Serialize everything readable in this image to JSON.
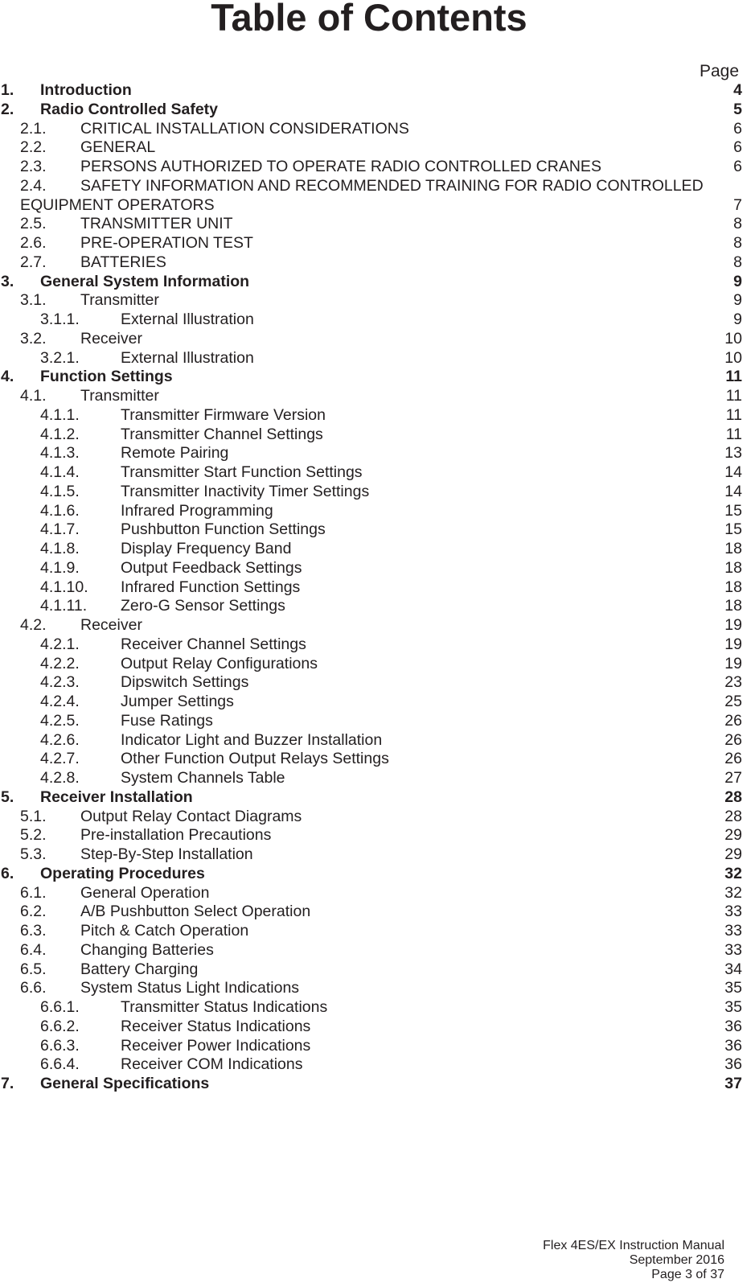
{
  "title": "Table of Contents",
  "page_column_header": "Page",
  "entries": [
    {
      "level": 1,
      "num": "1.",
      "text": "Introduction",
      "page": "4"
    },
    {
      "level": 1,
      "num": "2.",
      "text": "Radio Controlled Safety",
      "page": "5"
    },
    {
      "level": 2,
      "num": "2.1.",
      "text": "CRITICAL INSTALLATION CONSIDERATIONS",
      "page": "6"
    },
    {
      "level": 2,
      "num": "2.2.",
      "text": "GENERAL",
      "page": "6"
    },
    {
      "level": 2,
      "num": "2.3.",
      "text": "PERSONS AUTHORIZED TO OPERATE RADIO CONTROLLED CRANES",
      "page": "6"
    },
    {
      "level": 2,
      "num": "2.4.",
      "text": "SAFETY INFORMATION AND RECOMMENDED TRAINING FOR RADIO CONTROLLED",
      "text_cont": "EQUIPMENT OPERATORS",
      "page": "7"
    },
    {
      "level": 2,
      "num": "2.5.",
      "text": "TRANSMITTER UNIT",
      "page": "8"
    },
    {
      "level": 2,
      "num": "2.6.",
      "text": "PRE-OPERATION TEST",
      "page": "8"
    },
    {
      "level": 2,
      "num": "2.7.",
      "text": "BATTERIES",
      "page": "8"
    },
    {
      "level": 1,
      "num": "3.",
      "text": "General System Information",
      "page": "9"
    },
    {
      "level": 2,
      "num": "3.1.",
      "text": "Transmitter",
      "page": "9"
    },
    {
      "level": 3,
      "num": "3.1.1.",
      "text": "External Illustration",
      "page": "9"
    },
    {
      "level": 2,
      "num": "3.2.",
      "text": "Receiver",
      "page": "10"
    },
    {
      "level": 3,
      "num": "3.2.1.",
      "text": "External Illustration",
      "page": "10"
    },
    {
      "level": 1,
      "num": "4.",
      "text": "Function Settings",
      "page": "11"
    },
    {
      "level": 2,
      "num": "4.1.",
      "text": "Transmitter",
      "page": "11"
    },
    {
      "level": 3,
      "num": "4.1.1.",
      "text": "Transmitter Firmware Version",
      "page": "11"
    },
    {
      "level": 3,
      "num": "4.1.2.",
      "text": "Transmitter Channel Settings",
      "page": "11"
    },
    {
      "level": 3,
      "num": "4.1.3.",
      "text": "Remote Pairing",
      "page": "13"
    },
    {
      "level": 3,
      "num": "4.1.4.",
      "text": "Transmitter Start Function Settings",
      "page": "14"
    },
    {
      "level": 3,
      "num": "4.1.5.",
      "text": "Transmitter Inactivity Timer Settings",
      "page": "14"
    },
    {
      "level": 3,
      "num": "4.1.6.",
      "text": "Infrared Programming",
      "page": "15"
    },
    {
      "level": 3,
      "num": "4.1.7.",
      "text": "Pushbutton Function Settings",
      "page": "15"
    },
    {
      "level": 3,
      "num": "4.1.8.",
      "text": "Display Frequency Band",
      "page": "18"
    },
    {
      "level": 3,
      "num": "4.1.9.",
      "text": "Output Feedback Settings",
      "page": "18"
    },
    {
      "level": 3,
      "num": "4.1.10.",
      "text": "Infrared Function Settings",
      "page": "18"
    },
    {
      "level": 3,
      "num": "4.1.11.",
      "text": "Zero-G Sensor Settings",
      "page": "18"
    },
    {
      "level": 2,
      "num": "4.2.",
      "text": "Receiver",
      "page": "19"
    },
    {
      "level": 3,
      "num": "4.2.1.",
      "text": "Receiver Channel Settings",
      "page": "19"
    },
    {
      "level": 3,
      "num": "4.2.2.",
      "text": "Output Relay Configurations",
      "page": "19"
    },
    {
      "level": 3,
      "num": "4.2.3.",
      "text": "Dipswitch Settings",
      "page": "23"
    },
    {
      "level": 3,
      "num": "4.2.4.",
      "text": "Jumper Settings",
      "page": "25"
    },
    {
      "level": 3,
      "num": "4.2.5.",
      "text": "Fuse Ratings",
      "page": "26"
    },
    {
      "level": 3,
      "num": "4.2.6.",
      "text": "Indicator Light and Buzzer Installation",
      "page": "26"
    },
    {
      "level": 3,
      "num": "4.2.7.",
      "text": "Other Function Output Relays Settings",
      "page": "26"
    },
    {
      "level": 3,
      "num": "4.2.8.",
      "text": "System Channels Table",
      "page": "27"
    },
    {
      "level": 1,
      "num": "5.",
      "text": "Receiver Installation",
      "page": "28"
    },
    {
      "level": 2,
      "num": "5.1.",
      "text": "Output Relay Contact Diagrams",
      "page": "28"
    },
    {
      "level": 2,
      "num": "5.2.",
      "text": "Pre-installation Precautions",
      "page": "29"
    },
    {
      "level": 2,
      "num": "5.3.",
      "text": "Step-By-Step Installation",
      "page": "29"
    },
    {
      "level": 1,
      "num": "6.",
      "text": "Operating Procedures",
      "page": "32"
    },
    {
      "level": 2,
      "num": "6.1.",
      "text": "General Operation",
      "page": "32"
    },
    {
      "level": 2,
      "num": "6.2.",
      "text": "A/B Pushbutton Select Operation",
      "page": "33"
    },
    {
      "level": 2,
      "num": "6.3.",
      "text": "Pitch & Catch Operation",
      "page": "33"
    },
    {
      "level": 2,
      "num": "6.4.",
      "text": "Changing Batteries",
      "page": "33"
    },
    {
      "level": 2,
      "num": "6.5.",
      "text": "Battery Charging",
      "page": "34"
    },
    {
      "level": 2,
      "num": "6.6.",
      "text": "System Status Light Indications",
      "page": "35"
    },
    {
      "level": 3,
      "num": "6.6.1.",
      "text": "Transmitter Status Indications",
      "page": "35"
    },
    {
      "level": 3,
      "num": "6.6.2.",
      "text": "Receiver Status Indications",
      "page": "36"
    },
    {
      "level": 3,
      "num": "6.6.3.",
      "text": "Receiver Power Indications",
      "page": "36"
    },
    {
      "level": 3,
      "num": "6.6.4.",
      "text": "Receiver COM Indications",
      "page": "36"
    },
    {
      "level": 1,
      "num": "7.",
      "text": "General Specifications",
      "page": "37"
    }
  ],
  "footer": {
    "document": "Flex 4ES/EX Instruction Manual",
    "date": "September 2016",
    "page": "Page 3 of 37"
  }
}
